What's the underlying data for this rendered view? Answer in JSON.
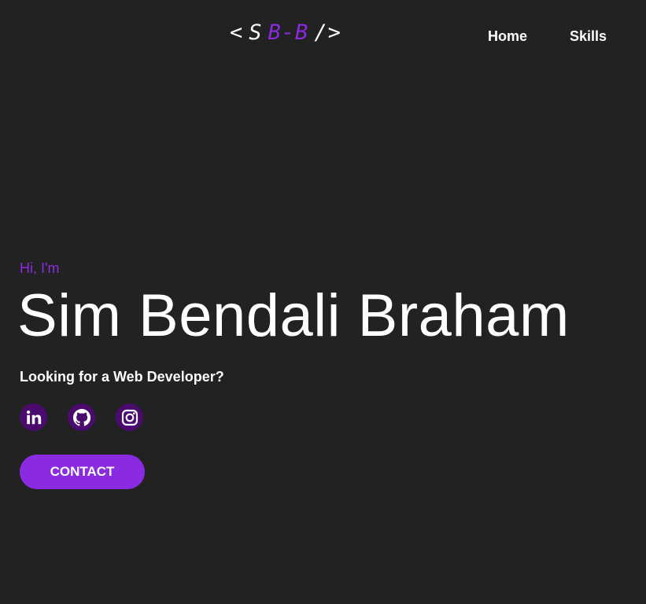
{
  "header": {
    "logo": {
      "open": "<",
      "initial": "S",
      "purple": "B-B",
      "close": "/>"
    },
    "nav": [
      "Home",
      "Skills"
    ]
  },
  "hero": {
    "greeting": "Hi, I'm",
    "name": "Sim Bendali Braham",
    "tagline": "Looking for a Web Developer?",
    "contact_label": "CONTACT"
  },
  "socials": [
    {
      "name": "linkedin",
      "icon": "linkedin-icon"
    },
    {
      "name": "github",
      "icon": "github-icon"
    },
    {
      "name": "instagram",
      "icon": "instagram-icon"
    }
  ],
  "colors": {
    "background": "#222222",
    "accent": "#8a2be2",
    "icon_circle": "#4a0a6e",
    "text": "#ffffff"
  }
}
